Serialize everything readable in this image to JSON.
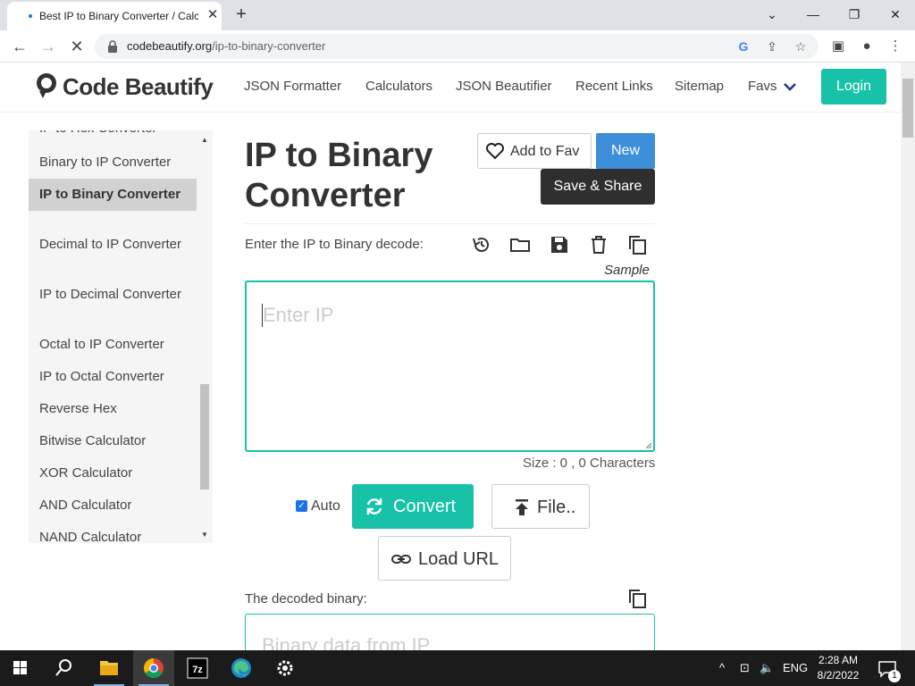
{
  "browser": {
    "tab_title": "Best IP to Binary Converter / Calculator",
    "new_tab": "+",
    "url_host": "codebeautify.org",
    "url_path": "/ip-to-binary-converter"
  },
  "header": {
    "logo_text": "Code Beautify",
    "nav": [
      "JSON Formatter",
      "Calculators",
      "JSON Beautifier",
      "Recent Links",
      "Sitemap",
      "Favs"
    ],
    "login_label": "Login"
  },
  "sidebar": {
    "items": [
      "IP to Hex Converter",
      "Binary to IP Converter",
      "IP to Binary Converter",
      "Decimal to IP Converter",
      "IP to Decimal Converter",
      "Octal to IP Converter",
      "IP to Octal Converter",
      "Reverse Hex",
      "Bitwise Calculator",
      "XOR Calculator",
      "AND Calculator",
      "NAND Calculator"
    ],
    "active_index": 2
  },
  "main": {
    "title": "IP to Binary Converter",
    "add_fav_label": "Add to Fav",
    "new_label": "New",
    "share_label": "Save & Share",
    "input_label": "Enter the IP to Binary decode:",
    "sample_label": "Sample",
    "input_placeholder": "Enter IP",
    "size_info": "Size : 0 , 0 Characters",
    "auto_label": "Auto",
    "auto_checked": true,
    "convert_label": "Convert",
    "file_label": "File..",
    "load_url_label": "Load URL",
    "output_label": "The decoded binary:",
    "output_placeholder": "Binary data from IP"
  },
  "taskbar": {
    "language": "ENG",
    "time": "2:28 AM",
    "date": "8/2/2022",
    "notification_count": "1"
  },
  "colors": {
    "accent": "#17c2a8",
    "new_button": "#3d8fd9",
    "share_button": "#2f2f2f",
    "sidebar_active": "#d1d1d1"
  }
}
